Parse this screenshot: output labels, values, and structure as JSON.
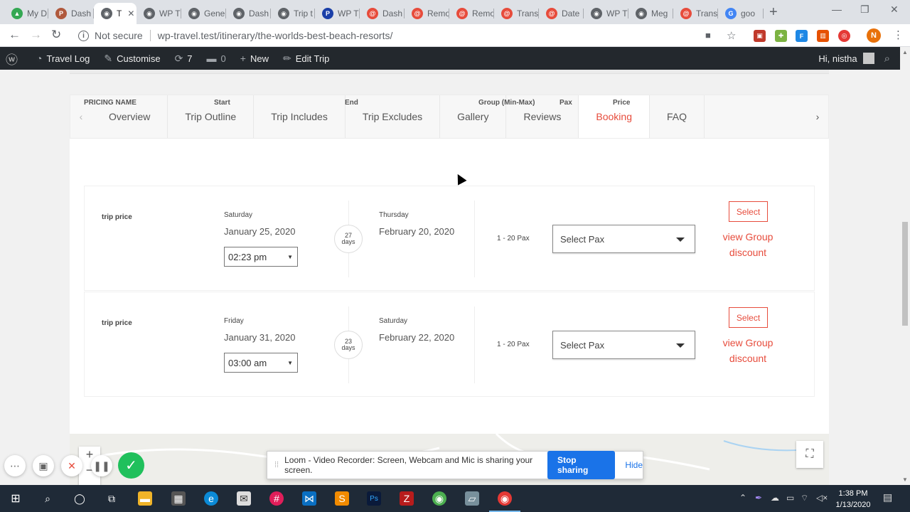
{
  "browser": {
    "tabs": [
      {
        "label": "My D",
        "color": "#34a853",
        "glyph": "▲"
      },
      {
        "label": "Dash",
        "color": "#b0593d",
        "glyph": "P"
      },
      {
        "label": "T",
        "color": "#5f6368",
        "glyph": "◉",
        "active": true
      },
      {
        "label": "WP T",
        "color": "#5f6368",
        "glyph": "◉"
      },
      {
        "label": "Gene",
        "color": "#5f6368",
        "glyph": "◉"
      },
      {
        "label": "Dash",
        "color": "#5f6368",
        "glyph": "◉"
      },
      {
        "label": "Trip t",
        "color": "#5f6368",
        "glyph": "◉"
      },
      {
        "label": "WP T",
        "color": "#1a3fa8",
        "glyph": "P"
      },
      {
        "label": "Dash",
        "color": "#e74c3c",
        "glyph": "@"
      },
      {
        "label": "Remo",
        "color": "#e74c3c",
        "glyph": "@"
      },
      {
        "label": "Remo",
        "color": "#e74c3c",
        "glyph": "@"
      },
      {
        "label": "Trans",
        "color": "#e74c3c",
        "glyph": "@"
      },
      {
        "label": "Date",
        "color": "#e74c3c",
        "glyph": "@"
      },
      {
        "label": "WP T",
        "color": "#5f6368",
        "glyph": "◉"
      },
      {
        "label": "Meg",
        "color": "#5f6368",
        "glyph": "◉"
      },
      {
        "label": "Trans",
        "color": "#e74c3c",
        "glyph": "@"
      },
      {
        "label": "goo",
        "color": "#4285f4",
        "glyph": "G"
      }
    ],
    "not_secure": "Not secure",
    "url": "wp-travel.test/itinerary/the-worlds-best-beach-resorts/",
    "profile_initial": "N"
  },
  "adminbar": {
    "site": "Travel Log",
    "customise": "Customise",
    "updates": "7",
    "comments": "0",
    "new": "New",
    "edit": "Edit Trip",
    "greeting": "Hi, nistha"
  },
  "trip_tabs": [
    {
      "label": "Overview"
    },
    {
      "label": "Trip Outline"
    },
    {
      "label": "Trip Includes"
    },
    {
      "label": "Trip Excludes"
    },
    {
      "label": "Gallery"
    },
    {
      "label": "Reviews"
    },
    {
      "label": "Booking",
      "active": true
    },
    {
      "label": "FAQ"
    }
  ],
  "table": {
    "headers": {
      "name": "PRICING NAME",
      "start": "Start",
      "end": "End",
      "group": "Group (Min-Max)",
      "pax": "Pax",
      "price": "Price"
    },
    "rows": [
      {
        "name": "trip price",
        "start_day": "Saturday",
        "start_date": "January 25, 2020",
        "time": "02:23 pm",
        "days_num": "27",
        "days_unit": "days",
        "end_day": "Thursday",
        "end_date": "February 20, 2020",
        "group": "1 - 20 Pax",
        "pax_placeholder": "Select Pax",
        "select_label": "Select",
        "discount_label": "view Group discount"
      },
      {
        "name": "trip price",
        "start_day": "Friday",
        "start_date": "January 31, 2020",
        "time": "03:00 am",
        "days_num": "23",
        "days_unit": "days",
        "end_day": "Saturday",
        "end_date": "February 22, 2020",
        "group": "1 - 20 Pax",
        "pax_placeholder": "Select Pax",
        "select_label": "Select",
        "discount_label": "view Group discount"
      }
    ]
  },
  "loom": {
    "message": "Loom - Video Recorder: Screen, Webcam and Mic is sharing your screen.",
    "stop": "Stop sharing",
    "hide": "Hide"
  },
  "taskbar": {
    "time": "1:38 PM",
    "date": "1/13/2020"
  },
  "colors": {
    "accent": "#e74c3c",
    "adminbar": "#23282d",
    "loom_button": "#1a73e8",
    "loom_done": "#20c05c"
  }
}
